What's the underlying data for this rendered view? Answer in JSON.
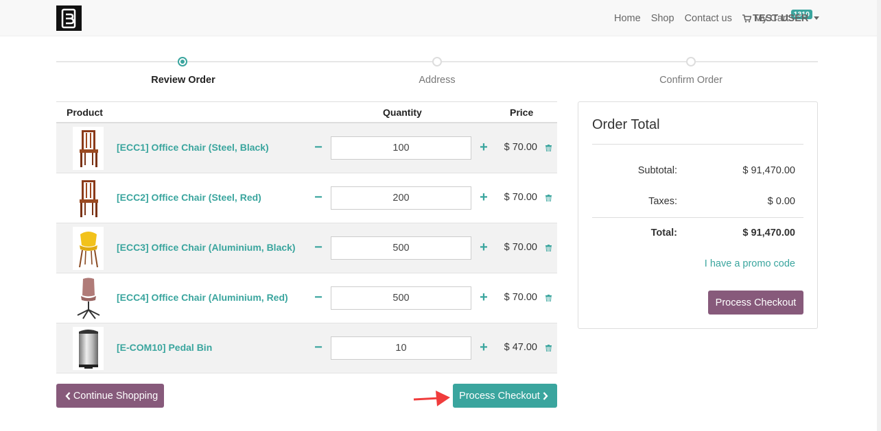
{
  "nav": {
    "links": [
      "Home",
      "Shop",
      "Contact us"
    ],
    "cart_label": "My Cart",
    "cart_count": "1310",
    "user": "TEST USER"
  },
  "steps": [
    {
      "label": "Review Order",
      "active": true
    },
    {
      "label": "Address",
      "active": false
    },
    {
      "label": "Confirm Order",
      "active": false
    }
  ],
  "table": {
    "headers": {
      "product": "Product",
      "quantity": "Quantity",
      "price": "Price"
    },
    "rows": [
      {
        "name": "[ECC1] Office Chair (Steel, Black)",
        "qty": "100",
        "price": "$ 70.00",
        "image": "wooden-chair-icon"
      },
      {
        "name": "[ECC2] Office Chair (Steel, Red)",
        "qty": "200",
        "price": "$ 70.00",
        "image": "wooden-chair-icon"
      },
      {
        "name": "[ECC3] Office Chair (Aluminium, Black)",
        "qty": "500",
        "price": "$ 70.00",
        "image": "yellow-chair-icon"
      },
      {
        "name": "[ECC4] Office Chair (Aluminium, Red)",
        "qty": "500",
        "price": "$ 70.00",
        "image": "swivel-chair-icon"
      },
      {
        "name": "[E-COM10] Pedal Bin",
        "qty": "10",
        "price": "$ 47.00",
        "image": "pedal-bin-icon"
      }
    ]
  },
  "buttons": {
    "continue": "Continue Shopping",
    "checkout": "Process Checkout"
  },
  "summary": {
    "title": "Order Total",
    "subtotal_label": "Subtotal:",
    "subtotal": "$ 91,470.00",
    "taxes_label": "Taxes:",
    "taxes": "$ 0.00",
    "total_label": "Total:",
    "total": "$ 91,470.00",
    "promo": "I have a promo code",
    "checkout": "Process Checkout"
  },
  "colors": {
    "accent": "#3aa59e",
    "brand": "#875a7b",
    "annotation_arrow": "#f03c3c"
  }
}
